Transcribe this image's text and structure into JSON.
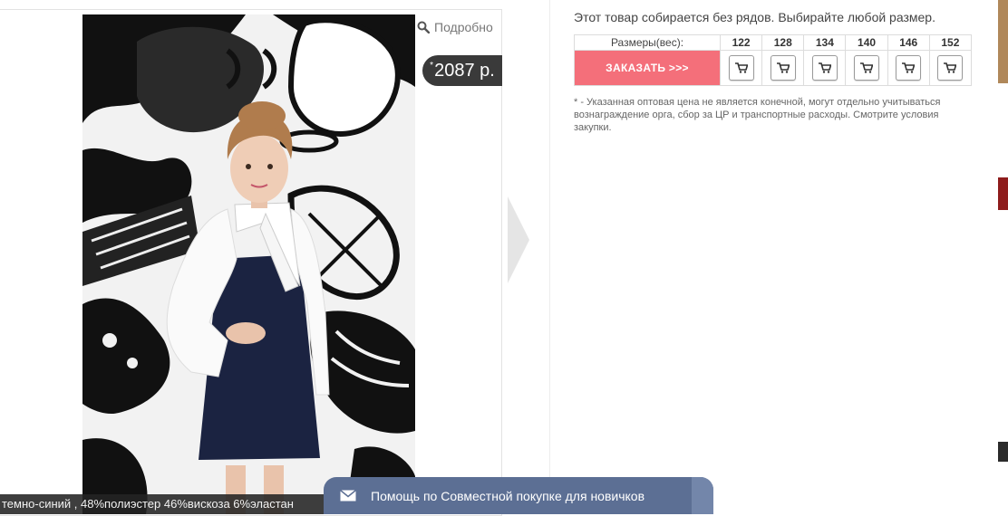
{
  "product": {
    "details_label": "Подробно",
    "price_mark": "*",
    "price": "2087 р.",
    "description": "темно-синий , 48%полиэстер 46%вискоза 6%эластан"
  },
  "order": {
    "notice": "Этот товар собирается без рядов. Выбирайте любой размер.",
    "size_header": "Размеры(вес):",
    "sizes": [
      "122",
      "128",
      "134",
      "140",
      "146",
      "152"
    ],
    "order_button": "ЗАКАЗАТЬ >>>",
    "footnote": "* - Указанная оптовая цена не является конечной, могут отдельно учитываться вознаграждение орга, сбор за ЦР и транспортные расходы. Смотрите условия закупки."
  },
  "help_bar": {
    "label": "Помощь по Совместной покупке для новичков"
  },
  "colors": {
    "order_button": "#f46f7a",
    "help_bar": "#5c6f94",
    "price_badge": "#3a3a3a"
  },
  "icons": [
    "search-icon",
    "cart-icon",
    "mail-icon",
    "chevron-right-icon"
  ]
}
